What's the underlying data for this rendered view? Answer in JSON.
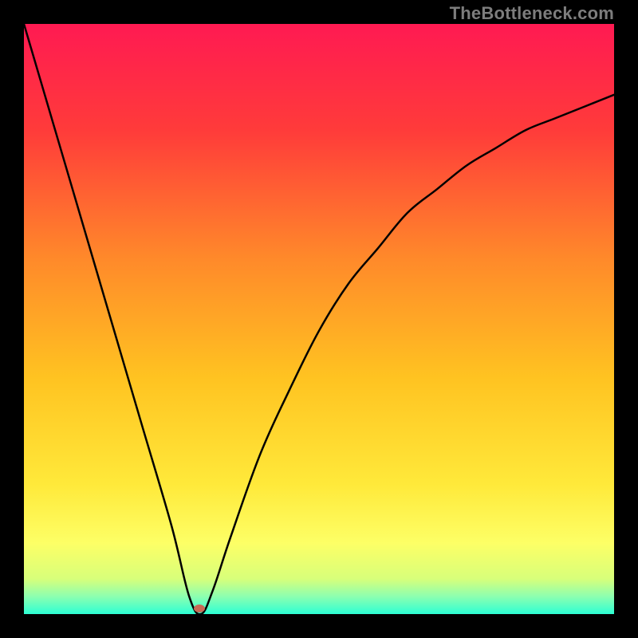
{
  "watermark": "TheBottleneck.com",
  "gradient_stops": [
    {
      "pct": 0,
      "color": "#ff1a52"
    },
    {
      "pct": 18,
      "color": "#ff3b3a"
    },
    {
      "pct": 40,
      "color": "#ff8a2a"
    },
    {
      "pct": 60,
      "color": "#ffc321"
    },
    {
      "pct": 78,
      "color": "#ffe93a"
    },
    {
      "pct": 88,
      "color": "#fdff66"
    },
    {
      "pct": 94,
      "color": "#d8ff7a"
    },
    {
      "pct": 97,
      "color": "#8dffb0"
    },
    {
      "pct": 100,
      "color": "#2dffd4"
    }
  ],
  "curve_color": "#000000",
  "marker": {
    "x_pct": 29.7,
    "y_pct": 99.0,
    "color": "#c96a56"
  },
  "chart_data": {
    "type": "line",
    "title": "",
    "xlabel": "",
    "ylabel": "",
    "xlim": [
      0,
      100
    ],
    "ylim": [
      0,
      100
    ],
    "grid": false,
    "legend": false,
    "series": [
      {
        "name": "bottleneck-curve",
        "x": [
          0,
          5,
          10,
          15,
          20,
          25,
          28,
          30,
          32,
          35,
          40,
          45,
          50,
          55,
          60,
          65,
          70,
          75,
          80,
          85,
          90,
          95,
          100
        ],
        "y": [
          100,
          83,
          66,
          49,
          32,
          15,
          3,
          0,
          4,
          13,
          27,
          38,
          48,
          56,
          62,
          68,
          72,
          76,
          79,
          82,
          84,
          86,
          88
        ]
      }
    ],
    "annotations": [
      {
        "type": "marker",
        "x": 29.7,
        "y": 1.0,
        "label": "optimal-point"
      }
    ]
  }
}
